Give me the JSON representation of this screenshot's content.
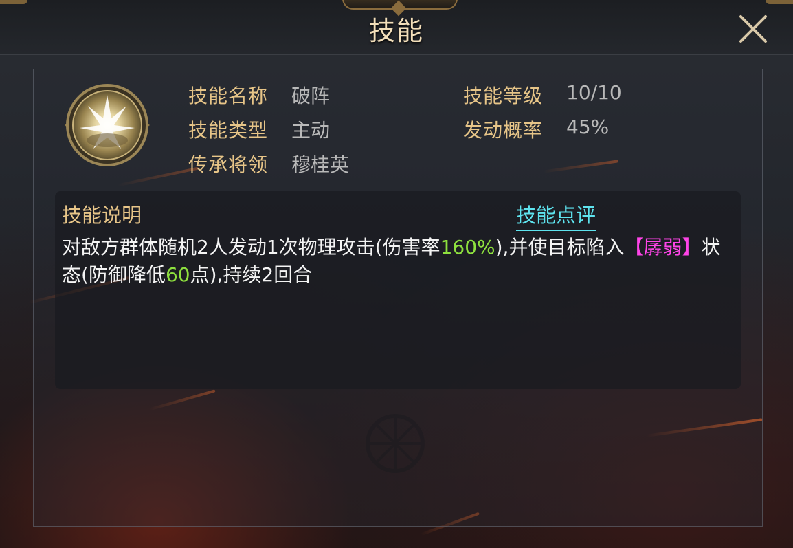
{
  "window": {
    "title": "技能",
    "close_icon": "close-icon"
  },
  "skill": {
    "icon": "burst-emblem-icon",
    "name_label": "技能名称",
    "name_value": "破阵",
    "type_label": "技能类型",
    "type_value": "主动",
    "general_label": "传承将领",
    "general_value": "穆桂英",
    "level_label": "技能等级",
    "level_value": "10/10",
    "chance_label": "发动概率",
    "chance_value": "45%"
  },
  "description": {
    "title": "技能说明",
    "review_link": "技能点评",
    "part1": "对敌方群体随机2人发动1次物理攻击(伤害率",
    "damage_rate": "160%",
    "part2": "),并使目标陷入",
    "status_open": "【",
    "status_name": "孱弱",
    "status_close": "】",
    "part3": "状态(防御降低",
    "defense_down": "60",
    "part4": "点),持续2回合"
  },
  "colors": {
    "label_gold": "#e7c588",
    "value_gray": "#b9b9b9",
    "link_cyan": "#5ee3ee",
    "highlight_green": "#8ee03e",
    "status_pink": "#ff44e8"
  }
}
